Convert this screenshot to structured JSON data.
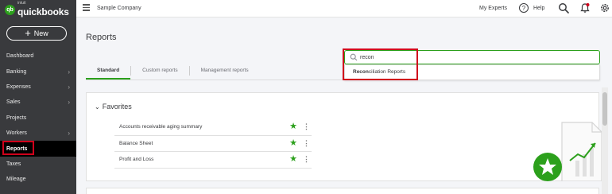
{
  "app": {
    "logo_small": "intuit",
    "logo_name": "quickbooks",
    "logo_badge": "qb",
    "new_button": "New",
    "new_button_icon": "+"
  },
  "sidebar": {
    "items": [
      {
        "label": "Dashboard",
        "chevron": ""
      },
      {
        "label": "Banking",
        "chevron": "›"
      },
      {
        "label": "Expenses",
        "chevron": "›"
      },
      {
        "label": "Sales",
        "chevron": "›"
      },
      {
        "label": "Projects",
        "chevron": ""
      },
      {
        "label": "Workers",
        "chevron": "›"
      },
      {
        "label": "Reports",
        "chevron": ""
      },
      {
        "label": "Taxes",
        "chevron": ""
      },
      {
        "label": "Mileage",
        "chevron": ""
      }
    ]
  },
  "topbar": {
    "company": "Sample Company",
    "my_experts": "My Experts",
    "help": "Help",
    "help_glyph": "?"
  },
  "page": {
    "title": "Reports",
    "tabs": [
      "Standard",
      "Custom reports",
      "Management reports"
    ]
  },
  "search": {
    "value": "recon",
    "result_match": "Recon",
    "result_rest": "ciliation Reports"
  },
  "favorites": {
    "title": "Favorites",
    "chevron": "⌄",
    "reports": [
      "Accounts receivable aging summary",
      "Balance Sheet",
      "Profit and Loss"
    ],
    "star_glyph": "★",
    "kebab_glyph": "⋮"
  },
  "colors": {
    "brand_green": "#2ca01c",
    "sidebar_bg": "#393a3d",
    "highlight_red": "#d0021b"
  }
}
